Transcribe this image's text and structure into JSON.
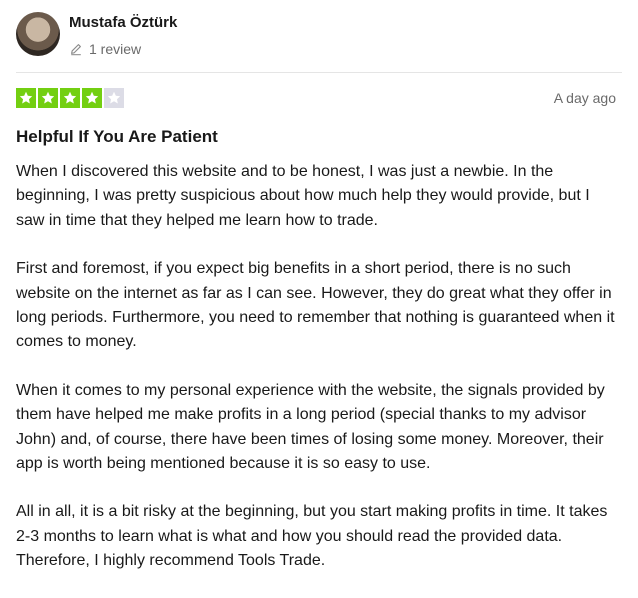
{
  "reviewer": {
    "name": "Mustafa Öztürk",
    "review_count": "1 review"
  },
  "rating": {
    "value": 4,
    "max": 5,
    "filled_color": "#73cf11",
    "empty_color": "#dcdce6"
  },
  "date": "A day ago",
  "title": "Helpful If You Are Patient",
  "paragraphs": [
    "When I discovered this website and to be honest, I was just a newbie. In the beginning, I was pretty suspicious about how much help they would provide, but I saw in time that they helped me learn how to trade.",
    "First and foremost, if you expect big benefits in a short period, there is no such website on the internet as far as I can see. However, they do great what they offer in long periods. Furthermore, you need to remember that nothing is guaranteed when it comes to money.",
    "When it comes to my personal experience with the website, the signals provided by them have helped me make profits in a long period (special thanks to my advisor John) and, of course, there have been times of losing some money. Moreover, their app is worth being mentioned because it is so easy to use.",
    "All in all, it is a bit risky at the beginning, but you start making profits in time. It takes 2-3 months to learn what is what and how you should read the provided data. Therefore, I highly recommend Tools Trade."
  ],
  "icons": {
    "avatar": "avatar",
    "review_count": "pencil-icon",
    "star": "star-icon"
  }
}
